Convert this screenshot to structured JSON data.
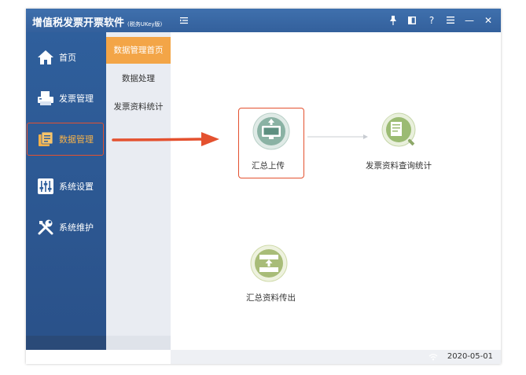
{
  "app": {
    "title": "增值税发票开票软件",
    "subtitle": "(税务UKey版)"
  },
  "titlebar_icons": [
    "pin-icon",
    "window-icon",
    "help-icon",
    "menu-icon",
    "minimize-icon",
    "close-icon"
  ],
  "titlebar_glyphs": {
    "help": "?",
    "minimize": "—",
    "close": "✕"
  },
  "sidebar": {
    "items": [
      {
        "label": "首页",
        "icon": "home-icon"
      },
      {
        "label": "发票管理",
        "icon": "printer-icon"
      },
      {
        "label": "数据管理",
        "icon": "data-icon",
        "active": true
      },
      {
        "label": "系统设置",
        "icon": "settings-sliders-icon"
      },
      {
        "label": "系统维护",
        "icon": "tools-icon"
      }
    ]
  },
  "subnav": {
    "items": [
      {
        "label": "数据管理首页",
        "active": true
      },
      {
        "label": "数据处理"
      },
      {
        "label": "发票资料统计"
      }
    ]
  },
  "functions": {
    "summary_upload": "汇总上传",
    "invoice_query": "发票资料查询统计",
    "summary_export": "汇总资料传出"
  },
  "status": {
    "date": "2020-05-01"
  },
  "colors": {
    "accent_orange": "#f3a547",
    "highlight_red": "#e4512f",
    "sidebar_blue": "#2f5f9c",
    "icon_green": "#8fb47a"
  }
}
